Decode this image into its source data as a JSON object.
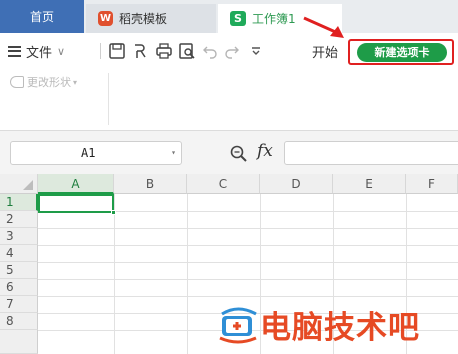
{
  "tabs": {
    "home": "首页",
    "template": "稻壳模板",
    "workbook": "工作簿1",
    "workbook_icon": "S"
  },
  "toolbar": {
    "file_label": "文件",
    "start_label": "开始",
    "new_tab_label": "新建选项卡",
    "change_shape_label": "更改形状",
    "accent_color": "#1e9c48",
    "highlight_color": "#e02020"
  },
  "formula_bar": {
    "name_box_value": "A1",
    "fx_label": "fx",
    "formula_value": ""
  },
  "sheet": {
    "columns": [
      "A",
      "B",
      "C",
      "D",
      "E",
      "F"
    ],
    "rows": [
      "1",
      "2",
      "3",
      "4",
      "5",
      "6",
      "7",
      "8"
    ],
    "selected_cell": "A1"
  },
  "watermark": {
    "text": "电脑技术吧",
    "color": "#e64a24"
  }
}
